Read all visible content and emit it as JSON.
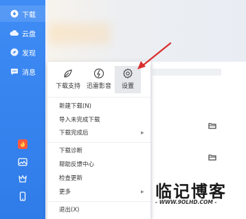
{
  "sidebar": {
    "items": [
      {
        "label": "下载",
        "icon": "download-icon",
        "active": true
      },
      {
        "label": "云盘",
        "icon": "cloud-icon",
        "active": false
      },
      {
        "label": "发现",
        "icon": "discover-icon",
        "active": false
      },
      {
        "label": "消息",
        "icon": "message-icon",
        "active": false
      }
    ],
    "bottom_icons": [
      "fire-app-icon",
      "image-icon",
      "crown-icon",
      "phone-icon"
    ],
    "accent": "#3482f0"
  },
  "menu": {
    "tools": [
      {
        "label": "下载支持",
        "icon": "download-support-icon"
      },
      {
        "label": "迅雷影音",
        "icon": "player-icon"
      },
      {
        "label": "设置",
        "icon": "gear-icon",
        "selected": true
      }
    ],
    "items": [
      {
        "label": "新建下载(N)"
      },
      {
        "label": "导入未完成下载"
      },
      {
        "label": "下载完成后",
        "submenu": true
      },
      {
        "label": "下载诊断"
      },
      {
        "label": "帮助反馈中心"
      },
      {
        "label": "检查更新"
      },
      {
        "label": "更多",
        "submenu": true
      },
      {
        "label": "退出(X)"
      }
    ]
  },
  "watermark": {
    "title": "临记博客",
    "url": "- WWW.9OLHD.COM -"
  },
  "colors": {
    "arrow": "#d9302f"
  }
}
